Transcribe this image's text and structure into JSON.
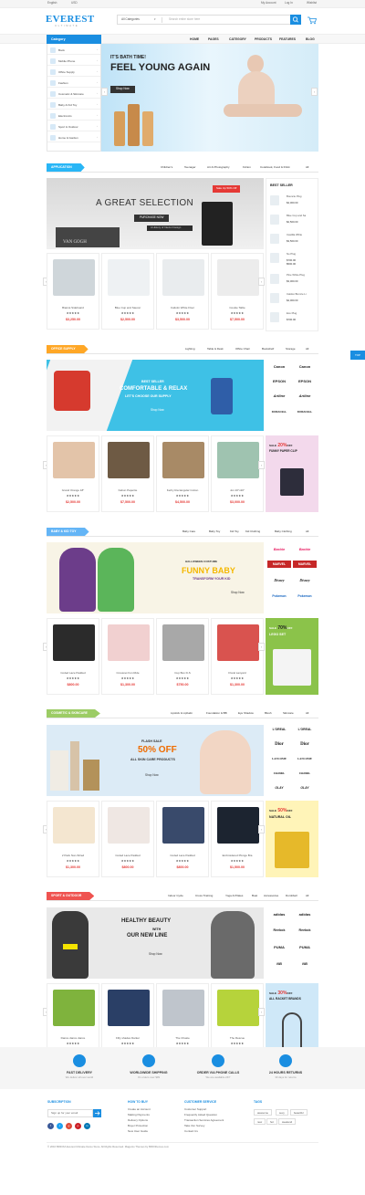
{
  "topbar": {
    "language": "English",
    "currency": "USD",
    "account": "My Account",
    "login": "Log In",
    "wishlist": "Wishlist"
  },
  "logo": {
    "name": "EVEREST",
    "tagline": "ULTIMATE"
  },
  "search": {
    "category": "All Categories",
    "placeholder": "Search entire store here"
  },
  "nav": {
    "category_label": "Category",
    "items": [
      "HOME",
      "PAGES",
      "CATEGORY",
      "PRODUCTS",
      "FEATURES",
      "BLOG"
    ]
  },
  "sidebar": {
    "items": [
      "Book",
      "Mobile Phone",
      "Office Supply",
      "Fashion",
      "Cosmetic & Skincare",
      "Baby & Kid Toy",
      "Electronics",
      "Sport & Outdoor",
      "Home & Garden"
    ]
  },
  "hero": {
    "subtitle": "IT'S BATH TIME!",
    "title": "FEEL YOUNG AGAIN",
    "button": "Shop Now"
  },
  "colors": {
    "accent": "#1a8ee1",
    "price": "#e53935",
    "application": "#29b6f6",
    "office": "#ffa726",
    "baby": "#64b5f6",
    "cosmetic": "#9ccc65",
    "sport": "#ef5350"
  },
  "sections": [
    {
      "tag": "APPLICATION",
      "tabs": [
        "Children's",
        "Teenager",
        "Art & Photography",
        "Fiction",
        "Cookbook, Food & Drink",
        "All"
      ],
      "banner": {
        "sale": "Sale Up 50% Off",
        "title": "A GREAT SELECTION",
        "button": "PURCHASE NOW",
        "book": "VAN GOGH",
        "book2": "A History of Interior Design"
      },
      "products": [
        {
          "name": "Bianca Sideboard",
          "price": "$3,250.00"
        },
        {
          "name": "Blue Cup and Saucer",
          "price": "$2,500.00"
        },
        {
          "name": "Caliotin White Floor",
          "price": "$3,500.00"
        },
        {
          "name": "Cookie Table",
          "price": "$7,500.00"
        }
      ],
      "bestseller": {
        "title": "BEST SELLER",
        "items": [
          {
            "name": "Bouncie Plug",
            "price": "$4,000.00"
          },
          {
            "name": "Blue Cup and Sa",
            "price": "$2,500.00"
          },
          {
            "name": "Castilla White",
            "price": "$3,500.00"
          },
          {
            "name": "No Plug",
            "price": "$700.00",
            "price2": "$500.00"
          },
          {
            "name": "Pine White Plug",
            "price": "$3,000.00"
          },
          {
            "name": "Caldon Bronze Li",
            "price": "$4,000.00"
          },
          {
            "name": "Eco Plug",
            "price": "$700.00"
          }
        ]
      }
    },
    {
      "tag": "OFFICE SUPPLY",
      "tabs": [
        "Lighting",
        "Table & Desk",
        "Office Chair",
        "Bookshelf",
        "Storage",
        "All"
      ],
      "banner": {
        "line1": "BEST SELLER",
        "line2": "COMFORTABLE & RELAX",
        "line3": "LET'S CHOOSE OUR SUPPLY",
        "button": "Shop Now"
      },
      "brands": [
        "Canon",
        "Canon",
        "EPSON",
        "EPSON",
        "Artline",
        "Artline",
        "DURACELL",
        "DURACELL"
      ],
      "products": [
        {
          "name": "Grand Orange 18\"",
          "price": "$2,500.00"
        },
        {
          "name": "Kabun Papertie",
          "price": "$7,500.00"
        },
        {
          "name": "Kerby Rectangular Cotton",
          "price": "$4,500.00"
        },
        {
          "name": "Jon 20\"x20\"",
          "price": "$3,000.00"
        }
      ],
      "promo": {
        "pre": "SALE",
        "pct": "20%",
        "off": "OFF",
        "text": "FUNNY PAPER CLIP"
      }
    },
    {
      "tag": "BABY & KID TOY",
      "tabs": [
        "Baby Care",
        "Baby Toy",
        "Kid Toy",
        "Kid Clothing",
        "Baby Clothing",
        "All"
      ],
      "banner": {
        "line1": "HALLOWEEN COSTUME",
        "line2": "FUNNY BABY",
        "line3": "TRANSFORM YOUR KID",
        "button": "Shop Now"
      },
      "brands": [
        "Barbie",
        "Barbie",
        "MARVEL",
        "MARVEL",
        "Disney",
        "Disney",
        "Pokemon",
        "Pokemon"
      ],
      "products": [
        {
          "name": "Coded Lace Padded",
          "price": "$800.00"
        },
        {
          "name": "Crossnet Fun Ride",
          "price": "$1,300.00"
        },
        {
          "name": "Cup Box D-S",
          "price": "$750.00"
        },
        {
          "name": "Floral Lanyard",
          "price": "$1,300.00"
        }
      ],
      "promo": {
        "pre": "SALE",
        "pct": "70%",
        "off": "OFF",
        "text": "LEGO SET"
      }
    },
    {
      "tag": "COSMETIC & SKINCARE",
      "tabs": [
        "Lipstick & Lipbalm",
        "Foundation & BB",
        "Eye Shadow",
        "Blush",
        "Skincare",
        "All"
      ],
      "banner": {
        "line1": "FLASH SALE",
        "line2": "50% OFF",
        "line3": "ALL SKIN CARE PRODUCTS",
        "button": "Shop Now"
      },
      "brands": [
        "L'OREAL",
        "L'OREAL",
        "Dior",
        "Dior",
        "LANCOME",
        "LANCOME",
        "CHANEL",
        "CHANEL",
        "OLAY",
        "OLAY"
      ],
      "products": [
        {
          "name": "2 Pack Non-Wired",
          "price": "$1,300.00"
        },
        {
          "name": "Coded Lace Padded",
          "price": "$800.00"
        },
        {
          "name": "Coded Lace Padded",
          "price": "$800.00"
        },
        {
          "name": "Embroidered Plunge Bra",
          "price": "$1,500.00"
        }
      ],
      "promo": {
        "pre": "SALE",
        "pct": "50%",
        "off": "OFF",
        "text": "NATURAL OIL"
      }
    },
    {
      "tag": "SPORT & OUTDOOR",
      "tabs": [
        "Indoor Cycle",
        "Cross Training",
        "Yoga & Pilates",
        "Boat",
        "Accessories",
        "Dumbbell",
        "All"
      ],
      "banner": {
        "line1": "HEALTHY BEAUTY",
        "line2": "WITH",
        "line3": "OUR NEW LINE",
        "button": "Shop Now"
      },
      "brands": [
        "adidas",
        "adidas",
        "Reebok",
        "Reebok",
        "PUMA",
        "PUMA",
        "NB",
        "NB"
      ],
      "products": [
        {
          "name": "Dance dance dance",
          "price": "$600.00"
        },
        {
          "name": "Fifty shades Darker",
          "price": "$150.00"
        },
        {
          "name": "The Chaste",
          "price": "$700.00"
        },
        {
          "name": "The Rescue",
          "price": "$110.00"
        }
      ],
      "promo": {
        "pre": "SALE",
        "pct": "30%",
        "off": "OFF",
        "text": "ALL RACKET BRANDS"
      }
    }
  ],
  "stars": "★★★★★",
  "features": [
    {
      "title": "FAST DELIVERY",
      "sub": "We deliver all over world"
    },
    {
      "title": "WORLDWIDE SHIPPING",
      "sub": "On orders over $99"
    },
    {
      "title": "ORDER VIA PHONE CALLS",
      "sub": "We are available 24/7"
    },
    {
      "title": "24 HOURS RETURNS",
      "sub": "30 days for returns"
    }
  ],
  "footer": {
    "subscription": {
      "title": "SUBSCRIPTION",
      "placeholder": "Sign up for your email"
    },
    "how_to_buy": {
      "title": "HOW TO BUY",
      "items": [
        "Create an Account",
        "Making Payments",
        "Delivery Options",
        "Buyer Protection",
        "New User Guide"
      ]
    },
    "customer_service": {
      "title": "CUSTOMER SERVICE",
      "items": [
        "Customer Support",
        "Frequently Asked Question",
        "Transaction Services Agreement",
        "Take Our Survey",
        "Contact Us"
      ]
    },
    "tags": {
      "title": "TAGS",
      "items": [
        "awesome",
        "sexy",
        "beautiful",
        "new",
        "hot",
        "weekend"
      ]
    },
    "social": [
      "f",
      "t",
      "g",
      "p",
      "in"
    ],
    "copyright": "© 2016 BRIOXA Everest Ultimate Demo Store. All Rights Reserved. Magento Themes by BRIOthemes.com"
  },
  "side_fixed": "TOP"
}
